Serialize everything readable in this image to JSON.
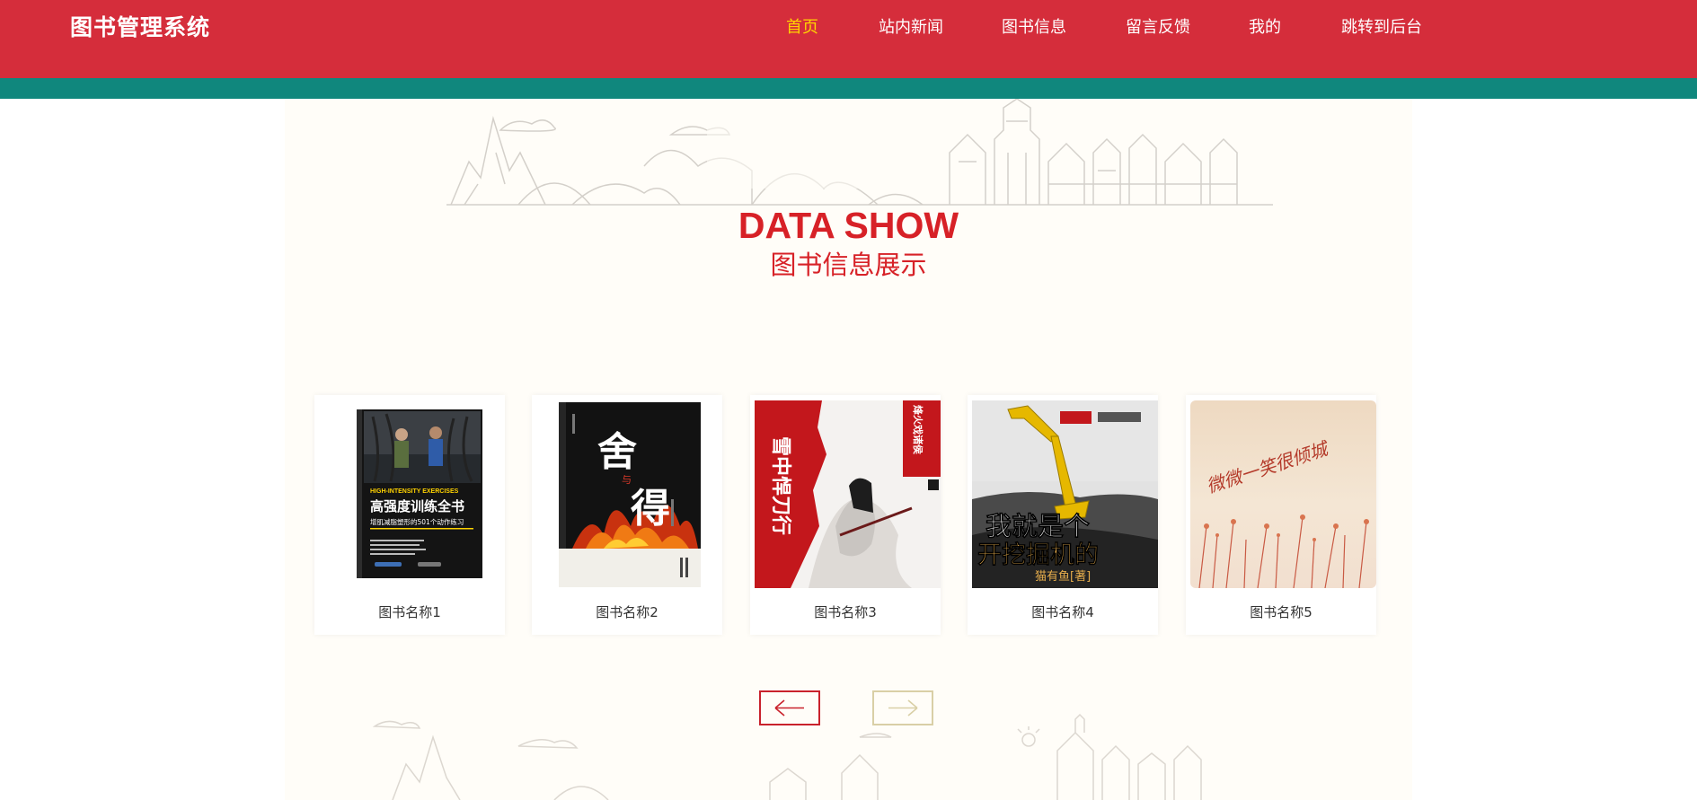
{
  "header": {
    "brand": "图书管理系统",
    "nav": [
      {
        "label": "首页",
        "active": true
      },
      {
        "label": "站内新闻",
        "active": false
      },
      {
        "label": "图书信息",
        "active": false
      },
      {
        "label": "留言反馈",
        "active": false
      },
      {
        "label": "我的",
        "active": false
      },
      {
        "label": "跳转到后台",
        "active": false
      }
    ]
  },
  "section": {
    "title_en": "DATA SHOW",
    "title_cn": "图书信息展示"
  },
  "books": [
    {
      "name": "图书名称1",
      "cover_text": {
        "english": "HIGH-INTENSITY EXERCISES",
        "title": "高强度训练全书",
        "subtitle": "增肌减脂塑形的501个动作练习"
      }
    },
    {
      "name": "图书名称2",
      "cover_text": {
        "title_a": "舍",
        "title_b": "与",
        "title_c": "得"
      }
    },
    {
      "name": "图书名称3",
      "cover_text": {
        "title": "雪中悍刀行",
        "author": "烽火戏诸侯"
      }
    },
    {
      "name": "图书名称4",
      "cover_text": {
        "title_line1": "我就是个",
        "title_line2": "开挖掘机的",
        "author": "猫有鱼[著]"
      }
    },
    {
      "name": "图书名称5",
      "cover_text": {
        "title": "微微一笑很倾城"
      }
    }
  ],
  "carousel": {
    "prev_icon": "arrow-left-icon",
    "next_icon": "arrow-right-icon",
    "prev_color": "#c9222c",
    "next_color": "#d9cfa6"
  },
  "colors": {
    "header": "#d52d3b",
    "accent_bar": "#10877d",
    "nav_active": "#ffd400",
    "title": "#d72127"
  }
}
